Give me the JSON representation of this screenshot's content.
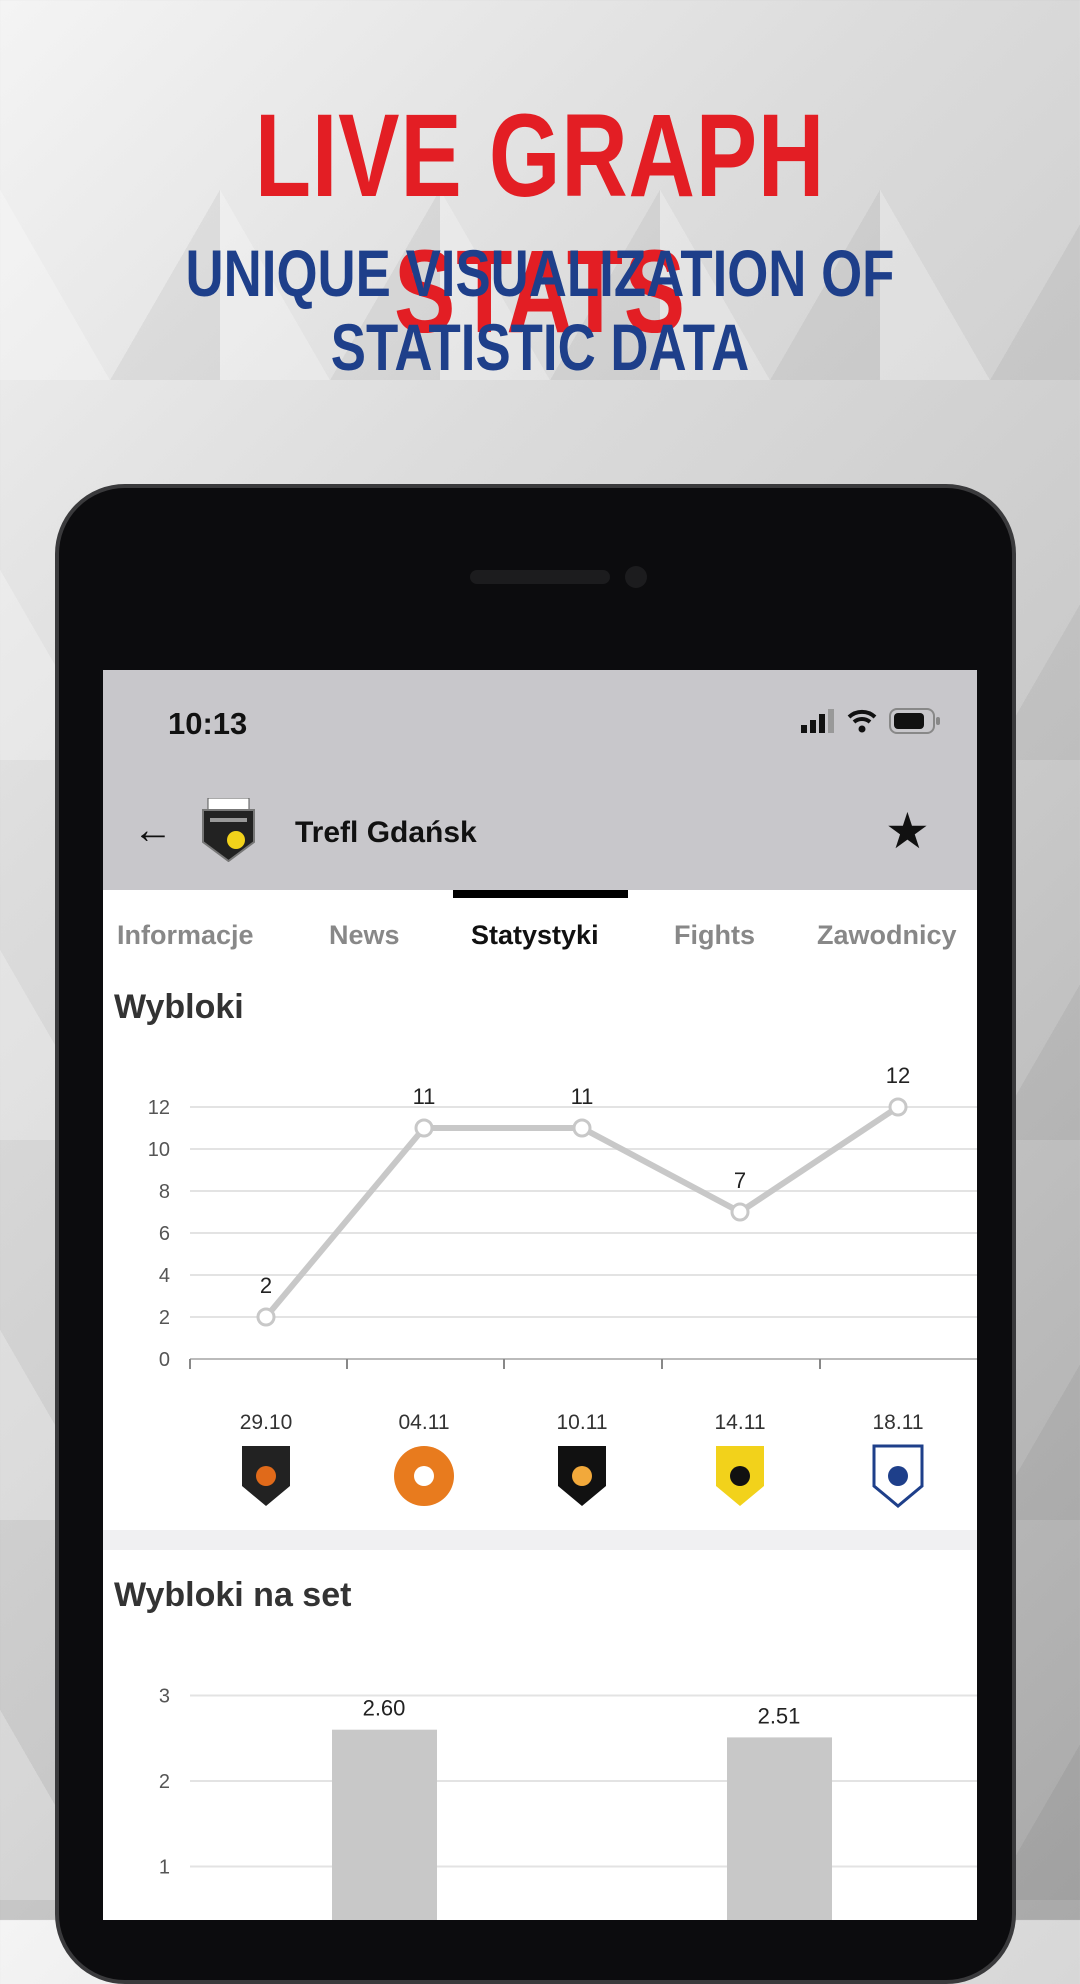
{
  "promo": {
    "headline": "LIVE GRAPH STATS",
    "subline": "UNIQUE VISUALIZATION OF STATISTIC DATA"
  },
  "status_bar": {
    "time": "10:13"
  },
  "header": {
    "team_name": "Trefl Gdańsk",
    "logo_text": "Trefl GDAŃSK"
  },
  "tabs": [
    {
      "label": "Informacje"
    },
    {
      "label": "News"
    },
    {
      "label": "Statystyki",
      "active": true
    },
    {
      "label": "Fights"
    },
    {
      "label": "Zawodnicy"
    }
  ],
  "colors": {
    "headline": "#e31e24",
    "subline": "#1e3f8a",
    "header_bg": "#c8c7cb",
    "line": "#c8c8c8",
    "bar": "#c8c8c8"
  },
  "sections": {
    "blocks_title": "Wybloki",
    "blocks_per_set_title": "Wybloki na set"
  },
  "chart_data": [
    {
      "type": "line",
      "title": "Wybloki",
      "categories": [
        "29.10",
        "04.11",
        "10.11",
        "14.11",
        "18.11"
      ],
      "opponent_icons": [
        "kakanh-logo",
        "cuprum-lubin-logo",
        "lkps-lublin-logo",
        "gks-katowice-logo",
        "projekt-warszawa-logo"
      ],
      "values": [
        2,
        11,
        11,
        7,
        12
      ],
      "yticks": [
        "0",
        "2",
        "4",
        "6",
        "8",
        "10",
        "12"
      ],
      "ylim": [
        0,
        12
      ],
      "grid": true
    },
    {
      "type": "bar",
      "title": "Wybloki na set",
      "values": [
        2.6,
        2.51
      ],
      "data_labels": [
        "2.60",
        "2.51"
      ],
      "yticks": [
        "1",
        "2",
        "3"
      ],
      "ylim": [
        0,
        3
      ],
      "grid": true
    }
  ]
}
